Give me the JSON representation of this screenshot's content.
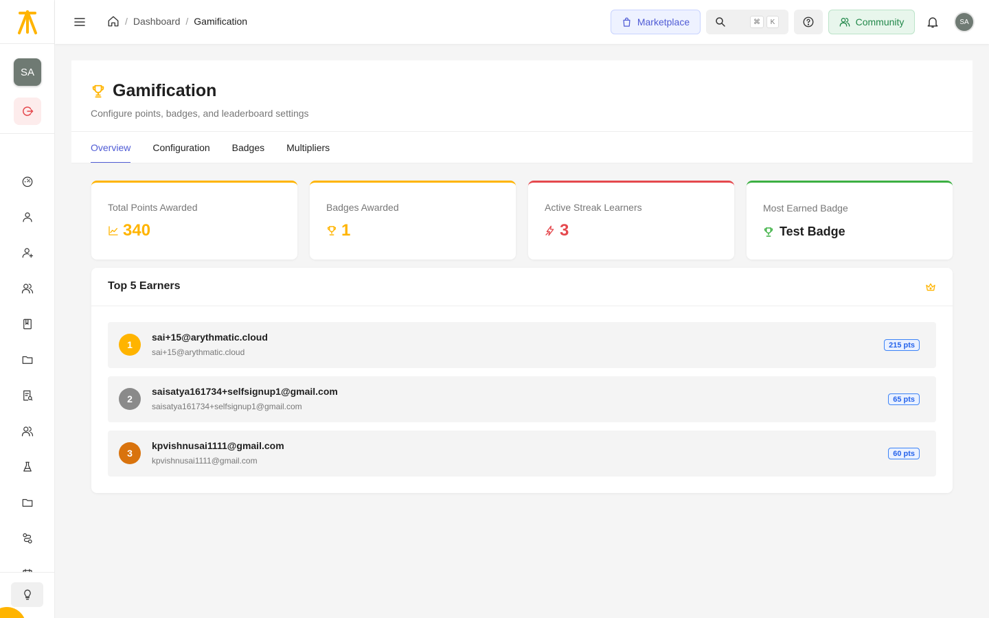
{
  "colors": {
    "brand": "#ffb400",
    "primary": "#4f5bd5",
    "community": "#22884a",
    "streak": "#e5484d",
    "badge_green": "#3cb043"
  },
  "sidebar": {
    "avatar_initials": "SA",
    "logout_icon": "logout-icon",
    "nav_icons": [
      "dashboard-icon",
      "user-icon",
      "user-plus-icon",
      "users-icon",
      "book-icon",
      "folder-icon",
      "report-icon",
      "users-icon",
      "flask-icon",
      "folder-icon",
      "route-icon",
      "calendar-icon"
    ],
    "bulb_icon": "lightbulb-icon"
  },
  "header": {
    "breadcrumb": [
      "Dashboard",
      "Gamification"
    ],
    "marketplace_label": "Marketplace",
    "search_shortcut": [
      "⌘",
      "K"
    ],
    "community_label": "Community",
    "avatar_initials": "SA"
  },
  "page": {
    "title": "Gamification",
    "subtitle": "Configure points, badges, and leaderboard settings",
    "tabs": [
      "Overview",
      "Configuration",
      "Badges",
      "Multipliers"
    ],
    "active_tab": "Overview"
  },
  "stats": [
    {
      "label": "Total Points Awarded",
      "value": "340",
      "icon": "trend-icon",
      "color": "#ffb400"
    },
    {
      "label": "Badges Awarded",
      "value": "1",
      "icon": "trophy-icon",
      "color": "#ffb400"
    },
    {
      "label": "Active Streak Learners",
      "value": "3",
      "icon": "flash-icon",
      "color": "#e5484d"
    },
    {
      "label": "Most Earned Badge",
      "value": "Test Badge",
      "icon": "trophy-icon",
      "color": "#3cb043"
    }
  ],
  "earners": {
    "title": "Top 5 Earners",
    "rows": [
      {
        "rank": "1",
        "name": "sai+15@arythmatic.cloud",
        "email": "sai+15@arythmatic.cloud",
        "points": "215 pts",
        "rank_color": "#ffb400"
      },
      {
        "rank": "2",
        "name": "saisatya161734+selfsignup1@gmail.com",
        "email": "saisatya161734+selfsignup1@gmail.com",
        "points": "65 pts",
        "rank_color": "#8a8a8a"
      },
      {
        "rank": "3",
        "name": "kpvishnusai1111@gmail.com",
        "email": "kpvishnusai1111@gmail.com",
        "points": "60 pts",
        "rank_color": "#d9730d"
      }
    ]
  }
}
